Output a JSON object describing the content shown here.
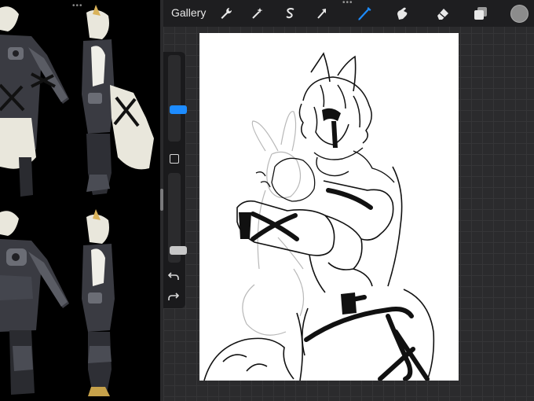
{
  "top_bar": {
    "gallery_label": "Gallery",
    "tools": {
      "actions": "wrench-icon",
      "adjustments": "magic-wand-icon",
      "selection": "selection-s-icon",
      "transform": "arrow-cursor-icon",
      "brush": "brush-icon",
      "smudge": "smudge-finger-icon",
      "eraser": "eraser-icon",
      "layers": "layers-icon"
    },
    "active_tool": "brush",
    "accent_color": "#1d8cff",
    "current_color": "#8c8c8c"
  },
  "sidebar": {
    "brush_size_level": 0.35,
    "opacity_level": 0.1,
    "undo_icon": "undo-arrow-icon",
    "redo_icon": "redo-arrow-icon"
  }
}
